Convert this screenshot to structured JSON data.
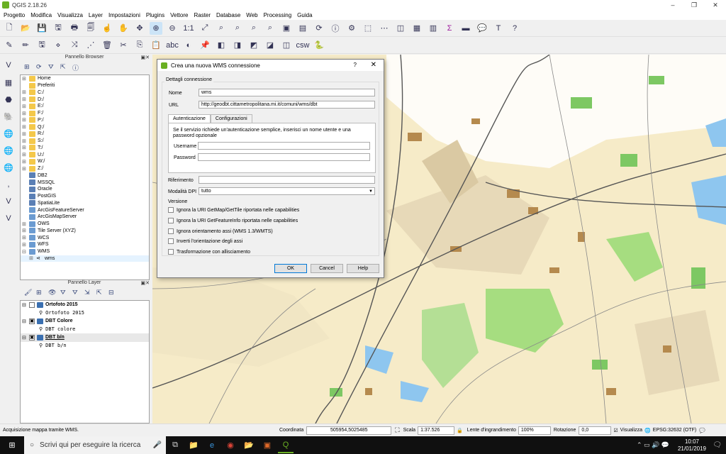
{
  "window": {
    "title": "QGIS 2.18.26",
    "min": "–",
    "max": "❐",
    "close": "✕"
  },
  "menu": [
    "Progetto",
    "Modifica",
    "Visualizza",
    "Layer",
    "Impostazioni",
    "Plugins",
    "Vettore",
    "Raster",
    "Database",
    "Web",
    "Processing",
    "Guida"
  ],
  "browser": {
    "title": "Pannello Browser",
    "items": [
      {
        "label": "Home",
        "icon": "folder",
        "exp": "⊞"
      },
      {
        "label": "Preferiti",
        "icon": "folder",
        "exp": ""
      },
      {
        "label": "C:/",
        "icon": "folder",
        "exp": "⊞"
      },
      {
        "label": "D:/",
        "icon": "folder",
        "exp": "⊞"
      },
      {
        "label": "E:/",
        "icon": "folder",
        "exp": "⊞"
      },
      {
        "label": "F:/",
        "icon": "folder",
        "exp": "⊞"
      },
      {
        "label": "P:/",
        "icon": "folder",
        "exp": "⊞"
      },
      {
        "label": "Q:/",
        "icon": "folder",
        "exp": "⊞"
      },
      {
        "label": "R:/",
        "icon": "folder",
        "exp": "⊞"
      },
      {
        "label": "S:/",
        "icon": "folder",
        "exp": "⊞"
      },
      {
        "label": "T:/",
        "icon": "folder",
        "exp": "⊞"
      },
      {
        "label": "U:/",
        "icon": "folder",
        "exp": "⊞"
      },
      {
        "label": "W:/",
        "icon": "folder",
        "exp": "⊞"
      },
      {
        "label": "Z:/",
        "icon": "folder",
        "exp": "⊞"
      },
      {
        "label": "DB2",
        "icon": "db",
        "exp": ""
      },
      {
        "label": "MSSQL",
        "icon": "db",
        "exp": ""
      },
      {
        "label": "Oracle",
        "icon": "db",
        "exp": ""
      },
      {
        "label": "PostGIS",
        "icon": "db",
        "exp": ""
      },
      {
        "label": "SpatiaLite",
        "icon": "db",
        "exp": ""
      },
      {
        "label": "ArcGisFeatureServer",
        "icon": "globe",
        "exp": ""
      },
      {
        "label": "ArcGisMapServer",
        "icon": "globe",
        "exp": ""
      },
      {
        "label": "OWS",
        "icon": "globe",
        "exp": "⊞"
      },
      {
        "label": "Tile Server (XYZ)",
        "icon": "globe",
        "exp": "⊞"
      },
      {
        "label": "WCS",
        "icon": "globe",
        "exp": "⊞"
      },
      {
        "label": "WFS",
        "icon": "globe",
        "exp": "⊞"
      },
      {
        "label": "WMS",
        "icon": "globe",
        "exp": "⊟"
      },
      {
        "label": "wms",
        "icon": "wms",
        "exp": "⊞",
        "indent": true
      }
    ]
  },
  "layers": {
    "title": "Pannello Layer",
    "items": [
      {
        "name": "Ortofoto 2015",
        "sub": "Ortofoto 2015",
        "checked": false
      },
      {
        "name": "DBT Colore",
        "sub": "DBT colore",
        "checked": true
      },
      {
        "name": "DBT b/n",
        "sub": "DBT b/n",
        "checked": true
      }
    ]
  },
  "dialog": {
    "title": "Crea una nuova WMS connessione",
    "help_q": "?",
    "close": "✕",
    "group": "Dettagli connessione",
    "name_label": "Nome",
    "name_value": "wms",
    "url_label": "URL",
    "url_value": "http://geodbt.cittametropolitana.mi.it/comuni/wms/dbt",
    "tab_auth": "Autenticazione",
    "tab_config": "Configurazioni",
    "auth_text": "Se il servizio richiede un'autenticazione semplice, inserisci un nome utente e una password opzionale",
    "user_label": "Username",
    "pass_label": "Password",
    "ref_label": "Riferimento",
    "dpi_label": "Modalità DPI",
    "dpi_value": "tutto",
    "version_label": "Versione",
    "options": [
      "Ignora la URI GetMap/GetTile riportata nelle capabilities",
      "Ignora la URI GetFeatureInfo riportata nelle capabilities",
      "Ignora orientamento assi (WMS 1.3/WMTS)",
      "Inverti l'orientazione degli assi",
      "Trasformazione con allisciamento"
    ],
    "ok": "OK",
    "cancel": "Cancel",
    "help": "Help"
  },
  "status": {
    "message": "Acquisizione mappa tramite WMS.",
    "coord_label": "Coordinata",
    "coord_value": "505954,5025485",
    "scale_label": "Scala",
    "scale_value": "1:37.526",
    "mag_label": "Lente d'ingrandimento",
    "mag_value": "100%",
    "rot_label": "Rotazione",
    "rot_value": "0,0",
    "render_label": "Visualizza",
    "crs": "EPSG:32632 (OTF)"
  },
  "taskbar": {
    "search": "Scrivi qui per eseguire la ricerca",
    "time": "10:07",
    "date": "21/01/2019"
  }
}
